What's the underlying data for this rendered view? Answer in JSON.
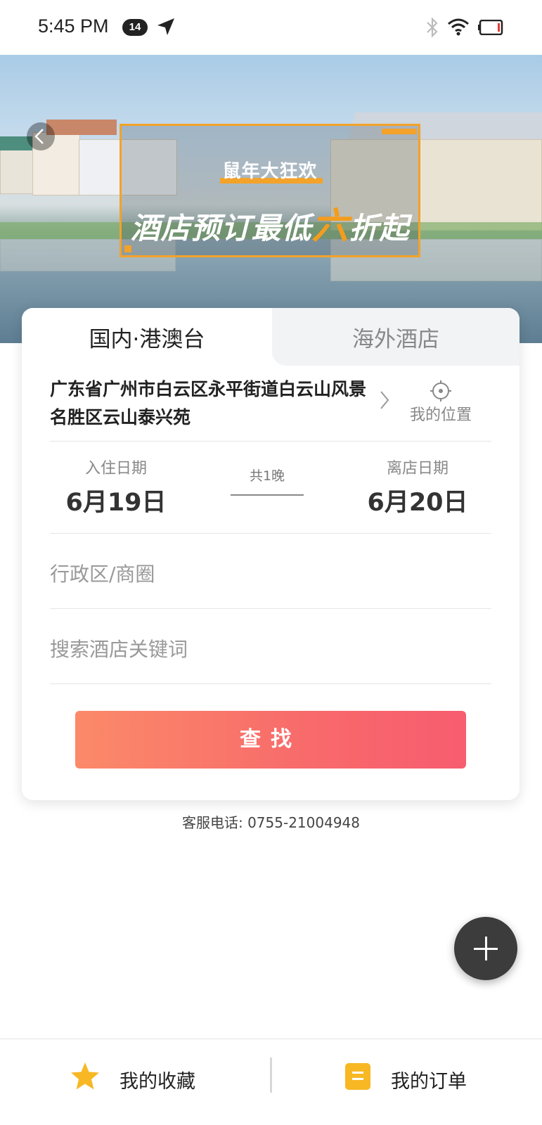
{
  "status_bar": {
    "time": "5:45 PM",
    "notification_count": "14"
  },
  "banner": {
    "promo_subtitle": "鼠年大狂欢",
    "promo_title_before": "酒店预订最低",
    "promo_title_highlight": "六",
    "promo_title_after": "折起"
  },
  "tabs": {
    "domestic": "国内·港澳台",
    "overseas": "海外酒店",
    "active": "domestic"
  },
  "location": {
    "address": "广东省广州市白云区永平街道白云山风景名胜区云山泰兴苑",
    "my_location_label": "我的位置"
  },
  "dates": {
    "checkin_label": "入住日期",
    "checkin_value": "6月19日",
    "nights": "共1晚",
    "checkout_label": "离店日期",
    "checkout_value": "6月20日"
  },
  "fields": {
    "district_placeholder": "行政区/商圈",
    "keyword_placeholder": "搜索酒店关键词"
  },
  "search_button": "查找",
  "hotline": "客服电话: 0755-21004948",
  "bottom_nav": {
    "favorites": "我的收藏",
    "orders": "我的订单"
  },
  "colors": {
    "accent_orange": "#f3a22a",
    "button_gradient_start": "#fb8a69",
    "button_gradient_end": "#f75c6f",
    "star": "#f7b824"
  }
}
